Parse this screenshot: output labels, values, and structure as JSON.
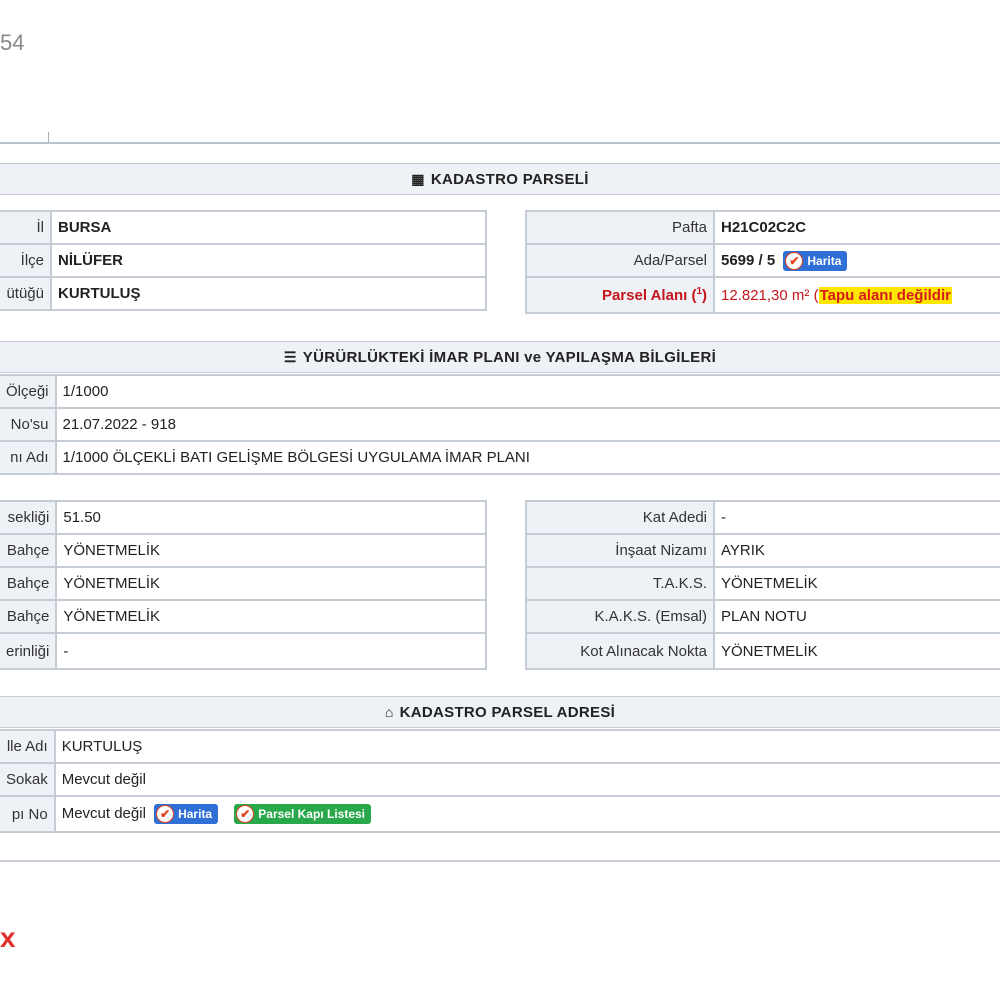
{
  "page": {
    "corner_fragment": "54",
    "corner_mark": "x"
  },
  "kadastro": {
    "title": "KADASTRO PARSELİ",
    "left_rows": [
      {
        "label": "İl",
        "value": "BURSA"
      },
      {
        "label": "İlçe",
        "value": "NİLÜFER"
      },
      {
        "label": "ütüğü",
        "value": "KURTULUŞ"
      }
    ],
    "pafta_label": "Pafta",
    "pafta_value": "H21C02C2C",
    "adaparsel_label": "Ada/Parsel",
    "adaparsel_value": "5699 / 5",
    "harita_button": "Harita",
    "parsel_alani_label": "Parsel Alanı (",
    "parsel_alani_sup": "1",
    "parsel_alani_label_end": ")",
    "parsel_alani_value": "12.821,30 m²",
    "open_paren": "(",
    "tapu_warning": "Tapu alanı değildir"
  },
  "imar": {
    "title": "YÜRÜRLÜKTEKİ İMAR PLANI ve YAPILAŞMA BİLGİLERİ",
    "rows": [
      {
        "label": "Ölçeği",
        "value": "1/1000"
      },
      {
        "label": "No'su",
        "value": "21.07.2022 - 918"
      },
      {
        "label": "nı Adı",
        "value": "1/1000 ÖLÇEKLİ BATI GELİŞME BÖLGESİ UYGULAMA İMAR PLANI"
      }
    ],
    "left_rows": [
      {
        "label": "sekliği",
        "value": "51.50"
      },
      {
        "label": "Bahçe",
        "value": "YÖNETMELİK"
      },
      {
        "label": "Bahçe",
        "value": "YÖNETMELİK"
      },
      {
        "label": "Bahçe",
        "value": "YÖNETMELİK"
      },
      {
        "label": "erinliği",
        "value": "-"
      }
    ],
    "right_rows": [
      {
        "label": "Kat Adedi",
        "value": "-"
      },
      {
        "label": "İnşaat Nizamı",
        "value": "AYRIK"
      },
      {
        "label": "T.A.K.S.",
        "value": "YÖNETMELİK"
      },
      {
        "label": "K.A.K.S. (Emsal)",
        "value": "PLAN NOTU"
      },
      {
        "label": "Kot Alınacak Nokta",
        "value": "YÖNETMELİK"
      }
    ]
  },
  "adres": {
    "title": "KADASTRO PARSEL ADRESİ",
    "rows": [
      {
        "label": "lle Adı",
        "value": "KURTULUŞ"
      },
      {
        "label": "Sokak",
        "value": "Mevcut değil"
      },
      {
        "label": "pı No",
        "value": "Mevcut değil"
      }
    ],
    "harita_button": "Harita",
    "kapi_button": "Parsel Kapı Listesi"
  },
  "colors": {
    "accent_red": "#c4161c",
    "warn_yellow": "#ffe600",
    "btn_blue": "#2f6fd6",
    "btn_green": "#28a84a"
  }
}
